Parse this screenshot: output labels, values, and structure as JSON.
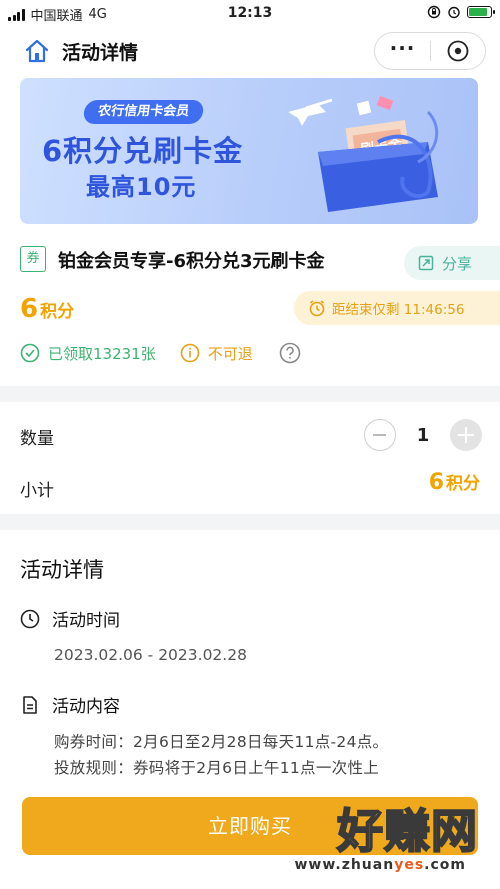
{
  "status_bar": {
    "carrier": "中国联通",
    "network": "4G",
    "time": "12:13",
    "icons": [
      "signal-icon",
      "lock-rotation-icon",
      "alarm-icon",
      "battery-icon"
    ]
  },
  "nav": {
    "title": "活动详情",
    "more_label": "···",
    "icons": [
      "home-icon",
      "more-icon",
      "close-miniprogram-icon"
    ]
  },
  "banner": {
    "tag": "农行信用卡会员",
    "line1": "6积分兑刷卡金",
    "line2": "最高10元",
    "box_label": "刷卡金"
  },
  "product": {
    "badge": "券",
    "title": "铂金会员专享-6积分兑3元刷卡金",
    "share_label": "分享",
    "points_value": "6",
    "points_unit": "积分",
    "countdown": "距结束仅剩 11:46:56",
    "claimed": "已领取13231张",
    "non_refundable": "不可退"
  },
  "quantity": {
    "label": "数量",
    "value": "1",
    "subtotal_label": "小计",
    "subtotal_value": "6",
    "subtotal_unit": "积分"
  },
  "details": {
    "heading": "活动详情",
    "time_label": "活动时间",
    "time_range": "2023.02.06 - 2023.02.28",
    "content_label": "活动内容",
    "content_line1": "购券时间：2月6日至2月28日每天11点-24点。",
    "content_line2": "投放规则：券码将于2月6日上午11点一次性上"
  },
  "footer": {
    "buy_label": "立即购买",
    "watermark_brand": "好赚网",
    "watermark_url_a": "www.zhuan",
    "watermark_url_b": "yes",
    "watermark_url_c": ".com"
  },
  "colors": {
    "accent_gold": "#f2a300",
    "green": "#3cb371",
    "teal": "#48b39c",
    "banner_blue": "#2f55dd",
    "button": "#f0a91d"
  }
}
